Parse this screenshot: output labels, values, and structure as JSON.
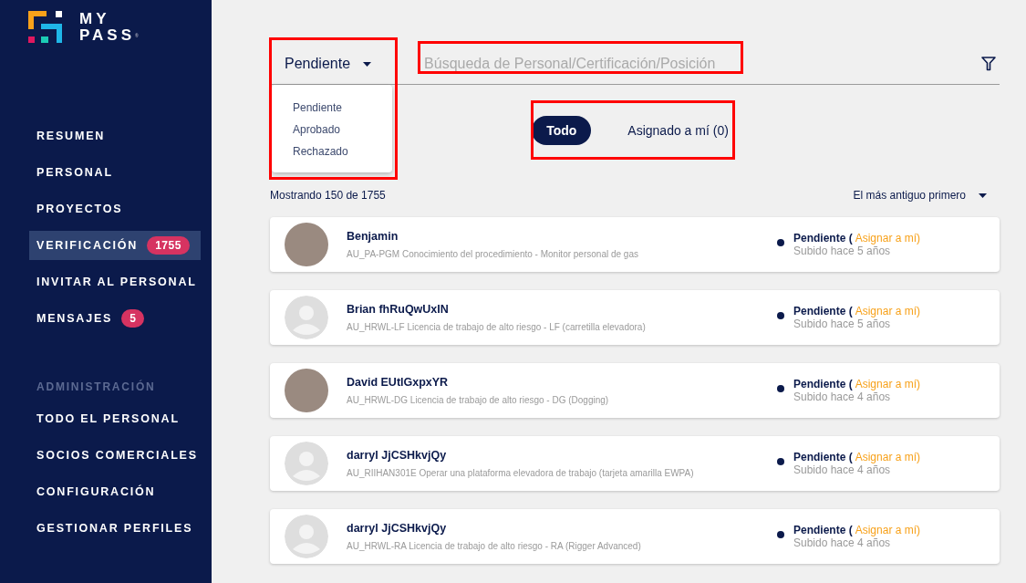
{
  "logo": {
    "line_1": "MY",
    "line_2": "PASS",
    "mark": "®"
  },
  "sidebar": {
    "items": [
      {
        "label": "RESUMEN",
        "selected": false
      },
      {
        "label": "PERSONAL",
        "selected": false
      },
      {
        "label": "PROYECTOS",
        "selected": false
      },
      {
        "label": "VERIFICACIÓN",
        "selected": true,
        "badge": "1755"
      },
      {
        "label": "INVITAR AL PERSONAL",
        "selected": false
      },
      {
        "label": "MENSAJES",
        "selected": false,
        "badge": "5"
      }
    ],
    "admin_section": {
      "title": "ADMINISTRACIÓN",
      "items": [
        {
          "label": "TODO EL PERSONAL",
          "selected": false
        },
        {
          "label": "SOCIOS COMERCIALES",
          "selected": false
        },
        {
          "label": "CONFIGURACIÓN",
          "selected": false
        },
        {
          "label": "GESTIONAR PERFILES",
          "selected": false
        }
      ]
    }
  },
  "status_filter": {
    "value": "Pendiente",
    "expanded": true,
    "options": [
      "Pendiente",
      "Aprobado",
      "Rechazado"
    ]
  },
  "search": {
    "placeholder": "Búsqueda de Personal/Certificación/Posición"
  },
  "assignment_tabs": [
    {
      "label": "Todo",
      "selected": true
    },
    {
      "label": "Asignado a mí (0)",
      "selected": false
    }
  ],
  "result_count": "Mostrando 150 de 1755",
  "sort": {
    "value": "El más antiguo primero"
  },
  "records": [
    {
      "name": "Benjamin",
      "certification": "AU_PA-PGM Conocimiento del procedimiento - Monitor personal de gas",
      "kind": "photo",
      "status": "Pendiente (",
      "action": "Asignar a mí)",
      "uploaded": "Subido hace 5 años"
    },
    {
      "name": "Brian fhRuQwUxIN",
      "certification": "AU_HRWL-LF Licencia de trabajo de alto riesgo - LF (carretilla elevadora)",
      "kind": "placeholder",
      "status": "Pendiente (",
      "action": "Asignar a mí)",
      "uploaded": "Subido hace 5 años"
    },
    {
      "name": "David EUtlGxpxYR",
      "certification": "AU_HRWL-DG Licencia de trabajo de alto riesgo - DG (Dogging)",
      "kind": "photo",
      "status": "Pendiente (",
      "action": "Asignar a mí)",
      "uploaded": "Subido hace 4 años"
    },
    {
      "name": "darryl JjCSHkvjQy",
      "certification": "AU_RIIHAN301E Operar una plataforma elevadora de trabajo (tarjeta amarilla EWPA)",
      "kind": "placeholder",
      "status": "Pendiente (",
      "action": "Asignar a mí)",
      "uploaded": "Subido hace 4 años"
    },
    {
      "name": "darryl JjCSHkvjQy",
      "certification": "AU_HRWL-RA Licencia de trabajo de alto riesgo - RA (Rigger Advanced)",
      "kind": "placeholder",
      "status": "Pendiente (",
      "action": "Asignar a mí)",
      "uploaded": "Subido hace 4 años"
    }
  ]
}
